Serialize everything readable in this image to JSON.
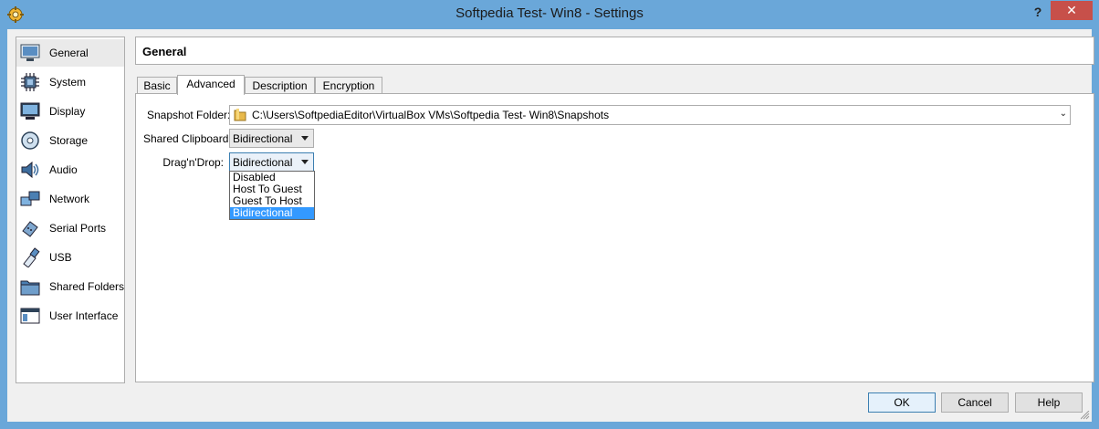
{
  "window": {
    "title": "Softpedia Test- Win8 - Settings",
    "help_label": "?",
    "close_label": "✕"
  },
  "sidebar": {
    "items": [
      {
        "label": "General",
        "icon": "general-icon",
        "selected": true
      },
      {
        "label": "System",
        "icon": "system-icon"
      },
      {
        "label": "Display",
        "icon": "display-icon"
      },
      {
        "label": "Storage",
        "icon": "storage-icon"
      },
      {
        "label": "Audio",
        "icon": "audio-icon"
      },
      {
        "label": "Network",
        "icon": "network-icon"
      },
      {
        "label": "Serial Ports",
        "icon": "serial-ports-icon"
      },
      {
        "label": "USB",
        "icon": "usb-icon"
      },
      {
        "label": "Shared Folders",
        "icon": "shared-folders-icon"
      },
      {
        "label": "User Interface",
        "icon": "user-interface-icon"
      }
    ]
  },
  "main": {
    "section_title": "General",
    "tabs": [
      {
        "label": "Basic"
      },
      {
        "label": "Advanced",
        "active": true
      },
      {
        "label": "Description"
      },
      {
        "label": "Encryption"
      }
    ],
    "advanced": {
      "snapshot_label": "Snapshot Folder:",
      "snapshot_path": "C:\\Users\\SoftpediaEditor\\VirtualBox VMs\\Softpedia Test- Win8\\Snapshots",
      "clipboard_label": "Shared Clipboard:",
      "clipboard_value": "Bidirectional",
      "dnd_label": "Drag'n'Drop:",
      "dnd_value": "Bidirectional",
      "dnd_options": [
        "Disabled",
        "Host To Guest",
        "Guest To Host",
        "Bidirectional"
      ],
      "dnd_highlighted": "Bidirectional"
    }
  },
  "buttons": {
    "ok": "OK",
    "cancel": "Cancel",
    "help": "Help"
  },
  "colors": {
    "title_bar": "#6aa7d9",
    "close_button": "#c7504a",
    "selection": "#3399ff"
  }
}
